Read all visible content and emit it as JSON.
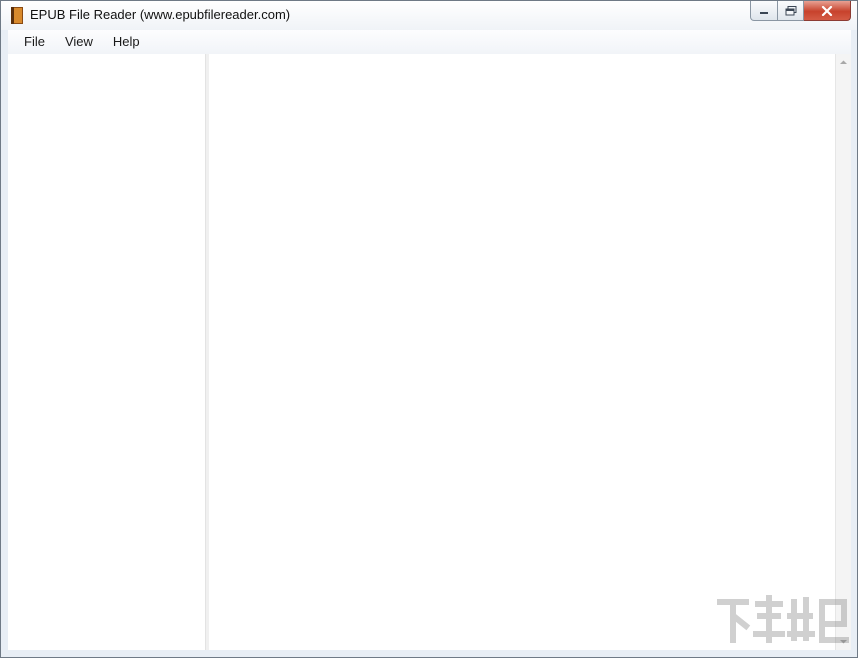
{
  "window": {
    "title": "EPUB File Reader (www.epubfilereader.com)",
    "app_icon": "book-icon"
  },
  "caption_buttons": {
    "minimize": "minimize-icon",
    "maximize": "maximize-icon",
    "close": "close-icon"
  },
  "menu": {
    "items": [
      {
        "label": "File"
      },
      {
        "label": "View"
      },
      {
        "label": "Help"
      }
    ]
  },
  "colors": {
    "window_frame": "#e8eef5",
    "close_button": "#c7422c",
    "content_background": "#ffffff"
  },
  "watermark": {
    "icon": "download-site-logo"
  }
}
